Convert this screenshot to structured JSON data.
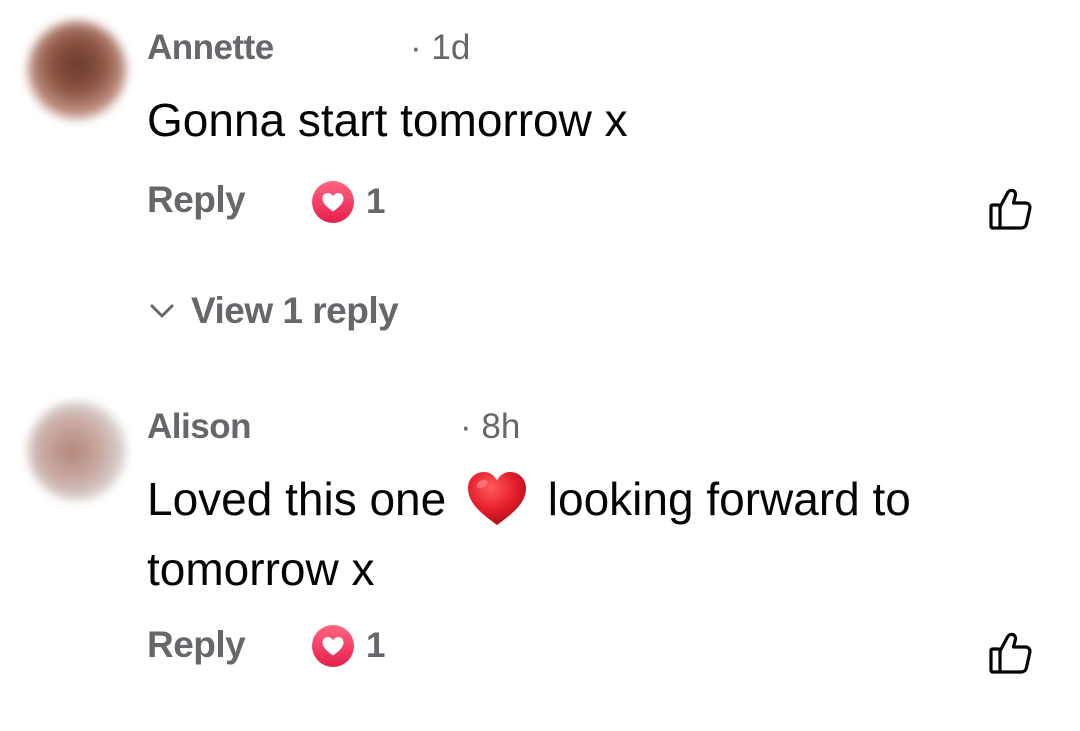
{
  "comments": [
    {
      "author": "Annette",
      "time": "· 1d",
      "text": "Gonna start tomorrow x",
      "reply_label": "Reply",
      "reaction_icon": "heart-icon",
      "reaction_count": "1",
      "like_icon": "thumbs-up-icon"
    },
    {
      "author": "Alison",
      "time": "· 8h",
      "text_before": "Loved this one",
      "text_emoji": "red-heart-emoji",
      "text_after": "looking forward to tomorrow x",
      "reply_label": "Reply",
      "reaction_icon": "heart-icon",
      "reaction_count": "1",
      "like_icon": "thumbs-up-icon"
    }
  ],
  "view_replies": {
    "label": "View 1 reply"
  },
  "colors": {
    "meta_text": "#65676b",
    "body_text": "#050505",
    "heart_badge": "#f02849",
    "emoji_heart": "#e41e3f"
  }
}
